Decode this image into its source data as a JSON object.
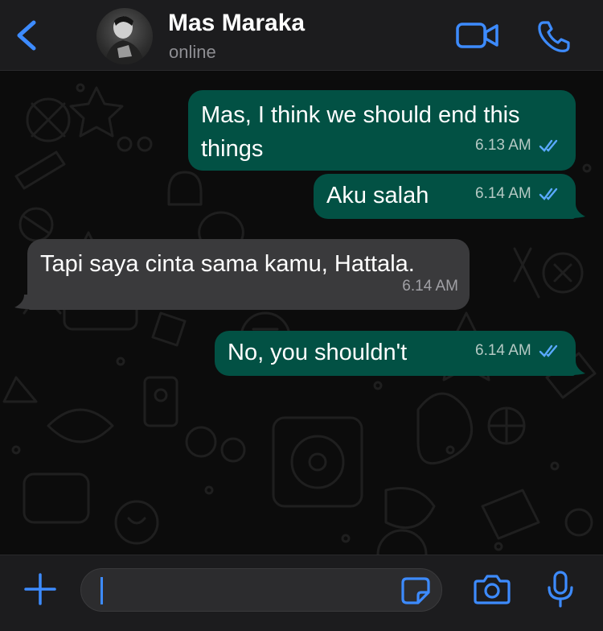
{
  "header": {
    "contact_name": "Mas Maraka",
    "status": "online",
    "icons": [
      "back-chevron-icon",
      "video-camera-icon",
      "phone-icon"
    ]
  },
  "messages": [
    {
      "direction": "outgoing",
      "text": "Mas, I think we should end this things",
      "time": "6.13 AM",
      "status": "read"
    },
    {
      "direction": "outgoing",
      "text": "Aku salah",
      "time": "6.14 AM",
      "status": "read"
    },
    {
      "direction": "incoming",
      "text": "Tapi saya cinta sama kamu, Hattala.",
      "time": "6.14 AM"
    },
    {
      "direction": "outgoing",
      "text": "No, you shouldn't",
      "time": "6.14 AM",
      "status": "read"
    }
  ],
  "composer": {
    "value": "",
    "icons": [
      "plus-icon",
      "sticker-icon",
      "camera-icon",
      "microphone-icon"
    ]
  },
  "colors": {
    "accent": "#3d8bff",
    "outgoing_bubble": "#025144",
    "incoming_bubble": "#3a3a3c",
    "read_tick": "#5aa9ff"
  }
}
